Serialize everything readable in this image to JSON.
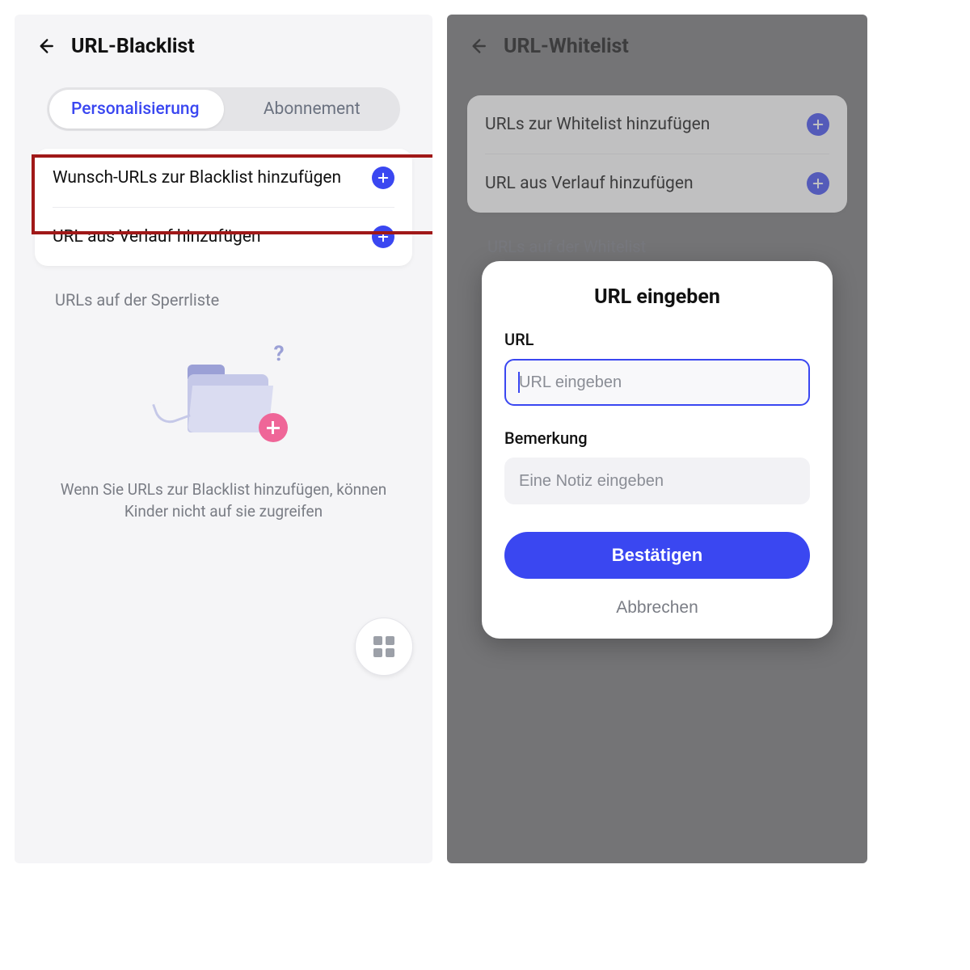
{
  "left": {
    "title": "URL-Blacklist",
    "tabs": {
      "personal": "Personalisierung",
      "subscription": "Abonnement"
    },
    "opt_add_desired": "Wunsch-URLs zur Blacklist hinzufügen",
    "opt_add_history": "URL aus Verlauf hinzufügen",
    "section_label": "URLs auf der Sperrliste",
    "empty_text": "Wenn Sie URLs zur Blacklist hinzufügen, können Kinder nicht auf sie zugreifen"
  },
  "right": {
    "title": "URL-Whitelist",
    "opt_add_whitelist": "URLs zur Whitelist hinzufügen",
    "opt_add_history": "URL aus Verlauf hinzufügen",
    "section_label": "URLs auf der Whitelist"
  },
  "modal": {
    "title": "URL eingeben",
    "url_label": "URL",
    "url_placeholder": "URL eingeben",
    "note_label": "Bemerkung",
    "note_placeholder": "Eine Notiz eingeben",
    "confirm": "Bestätigen",
    "cancel": "Abbrechen"
  },
  "colors": {
    "accent": "#3a47f1",
    "highlight": "#a01818",
    "pink": "#ef6698"
  }
}
